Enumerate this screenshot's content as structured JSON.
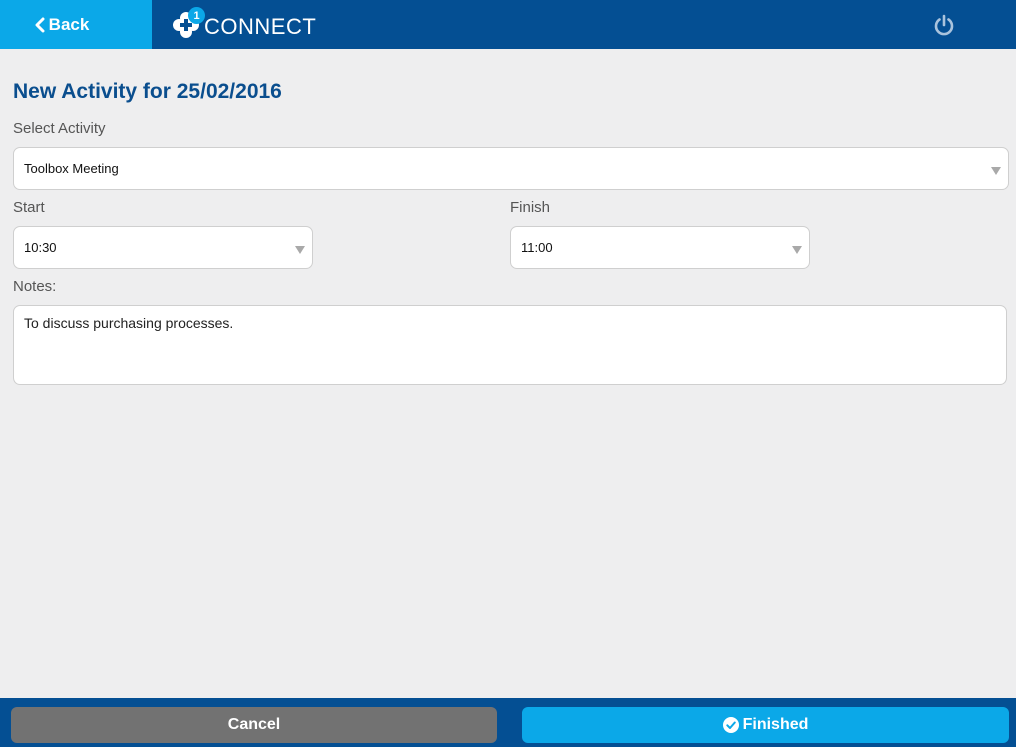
{
  "header": {
    "back_label": "Back",
    "brand_name": "CONNECT",
    "brand_badge": "1",
    "colors": {
      "bar": "#044f93",
      "accent": "#0ba8e8"
    }
  },
  "form": {
    "title": "New Activity for 25/02/2016",
    "activity_label": "Select Activity",
    "activity_value": "Toolbox Meeting",
    "start_label": "Start",
    "start_value": "10:30",
    "finish_label": "Finish",
    "finish_value": "11:00",
    "notes_label": "Notes:",
    "notes_value": "To discuss purchasing processes."
  },
  "footer": {
    "cancel_label": "Cancel",
    "finished_label": "Finished",
    "colors": {
      "cancel": "#727272",
      "finished": "#0ba8e8"
    }
  },
  "icons": [
    "chevron-left-icon",
    "app-logo-icon",
    "power-icon",
    "check-circle-icon",
    "dropdown-arrow-icon"
  ]
}
